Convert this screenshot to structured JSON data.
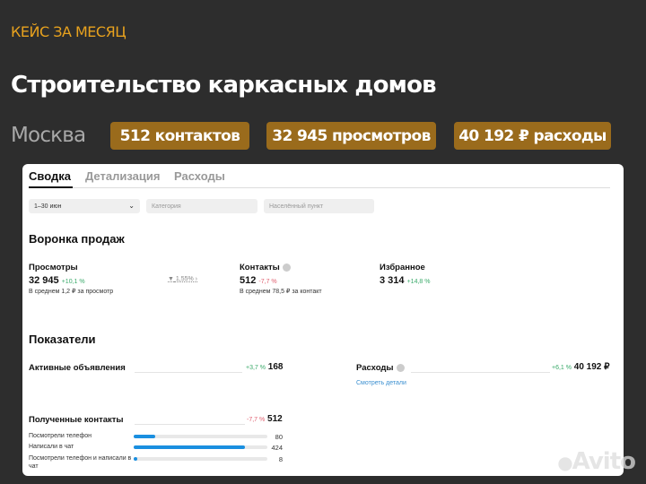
{
  "kicker": "КЕЙС ЗА МЕСЯЦ",
  "title": "Строительство каркасных домов",
  "city": "Москва",
  "badges": [
    "512 контактов",
    "32 945 просмотров",
    "40 192 ₽ расходы"
  ],
  "tabs": [
    "Сводка",
    "Детализация",
    "Расходы"
  ],
  "filters": {
    "period": "1–30 июн",
    "category_placeholder": "Категория",
    "city_placeholder": "Населённый пункт"
  },
  "funnel": {
    "title": "Воронка продаж",
    "views": {
      "label": "Просмотры",
      "value": "32 945",
      "change": "+10,1 %",
      "sub": "В среднем 1,2 ₽ за просмотр"
    },
    "conversion": "1,55% ›",
    "contacts": {
      "label": "Контакты",
      "value": "512",
      "change": "-7,7 %",
      "sub": "В среднем 78,5 ₽ за контакт"
    },
    "favorites": {
      "label": "Избранное",
      "value": "3 314",
      "change": "+14,8 %"
    }
  },
  "indicators": {
    "title": "Показатели",
    "active": {
      "label": "Активные объявления",
      "change": "+3,7 %",
      "value": "168"
    },
    "expenses": {
      "label": "Расходы",
      "change": "+6,1 %",
      "value": "40 192 ₽",
      "link": "Смотреть детали"
    },
    "contacts": {
      "label": "Полученные контакты",
      "change": "-7,7 %",
      "value": "512",
      "rows": [
        {
          "label": "Посмотрели телефон",
          "value": "80",
          "share": 0.16
        },
        {
          "label": "Написали в чат",
          "value": "424",
          "share": 0.83
        },
        {
          "label": "Посмотрели телефон и написали в чат",
          "value": "8",
          "share": 0.02
        }
      ]
    }
  },
  "watermark": "Avito",
  "colors": {
    "accent": "#e8a21e",
    "badge": "#9a6b1c",
    "bar": "#1a8fe0",
    "up": "#3aaa6a",
    "down": "#e06070"
  }
}
